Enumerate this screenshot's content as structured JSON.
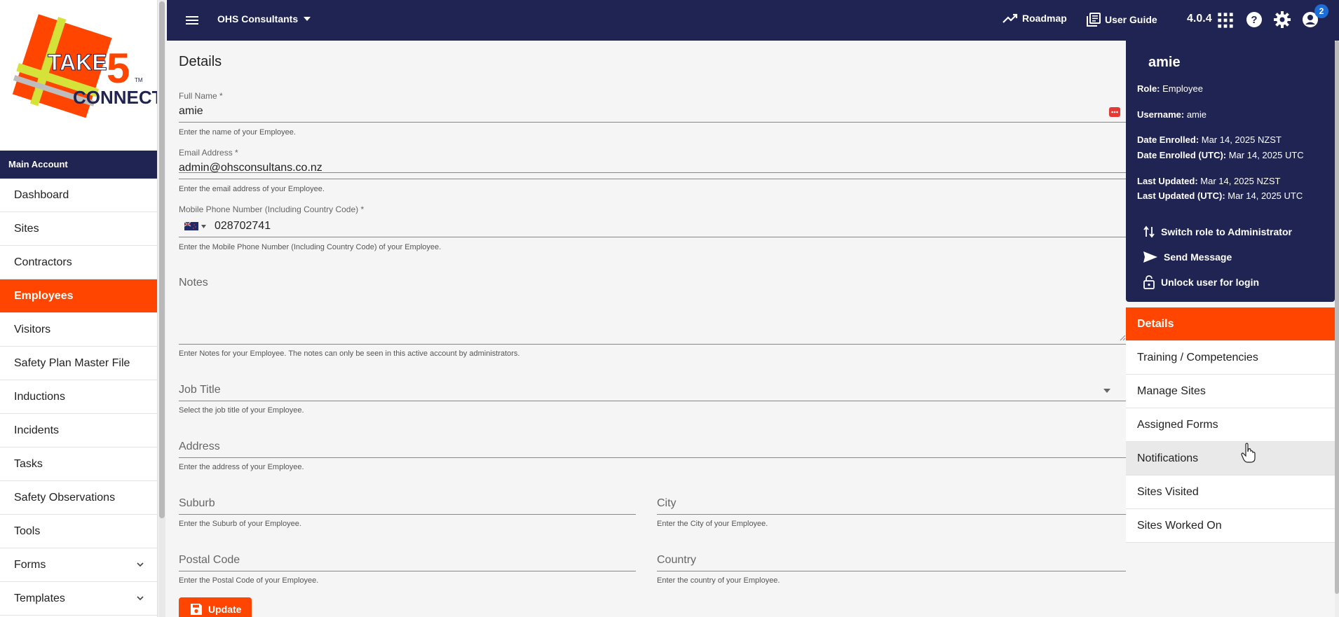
{
  "logo": {
    "text_main": "TAKE",
    "text_num": "5",
    "text_sub": "CONNECT",
    "tm": "TM"
  },
  "sidebar": {
    "section_title": "Main Account",
    "items": [
      {
        "label": "Dashboard"
      },
      {
        "label": "Sites"
      },
      {
        "label": "Contractors"
      },
      {
        "label": "Employees"
      },
      {
        "label": "Visitors"
      },
      {
        "label": "Safety Plan Master File"
      },
      {
        "label": "Inductions"
      },
      {
        "label": "Incidents"
      },
      {
        "label": "Tasks"
      },
      {
        "label": "Safety Observations"
      },
      {
        "label": "Tools"
      },
      {
        "label": "Forms"
      },
      {
        "label": "Templates"
      }
    ],
    "active_item": "Employees"
  },
  "topbar": {
    "account": "OHS Consultants",
    "roadmap": "Roadmap",
    "user_guide": "User Guide",
    "version": "4.0.4",
    "notification_count": "2"
  },
  "form": {
    "title": "Details",
    "full_name": {
      "label": "Full Name *",
      "value": "amie",
      "helper": "Enter the name of your Employee."
    },
    "email": {
      "label": "Email Address *",
      "value": "admin@ohsconsultans.co.nz",
      "helper": "Enter the email address of your Employee."
    },
    "mobile": {
      "label": "Mobile Phone Number (Including Country Code) *",
      "value": "028702741",
      "helper": "Enter the Mobile Phone Number (Including Country Code) of your Employee."
    },
    "notes": {
      "placeholder": "Notes",
      "helper": "Enter Notes for your Employee. The notes can only be seen in this active account by administrators."
    },
    "job_title": {
      "placeholder": "Job Title",
      "helper": "Select the job title of your Employee."
    },
    "address": {
      "placeholder": "Address",
      "helper": "Enter the address of your Employee."
    },
    "suburb": {
      "placeholder": "Suburb",
      "helper": "Enter the Suburb of your Employee."
    },
    "city": {
      "placeholder": "City",
      "helper": "Enter the City of your Employee."
    },
    "postal_code": {
      "placeholder": "Postal Code",
      "helper": "Enter the Postal Code of your Employee."
    },
    "country": {
      "placeholder": "Country",
      "helper": "Enter the country of your Employee."
    },
    "update_label": "Update"
  },
  "user_card": {
    "name": "amie",
    "role_label": "Role:",
    "role": "Employee",
    "username_label": "Username:",
    "username": "amie",
    "enrolled_label": "Date Enrolled:",
    "enrolled": "Mar 14, 2025 NZST",
    "enrolled_utc_label": "Date Enrolled (UTC):",
    "enrolled_utc": "Mar 14, 2025 UTC",
    "updated_label": "Last Updated:",
    "updated": "Mar 14, 2025 NZST",
    "updated_utc_label": "Last Updated (UTC):",
    "updated_utc": "Mar 14, 2025 UTC",
    "actions": {
      "switch_role": "Switch role to Administrator",
      "send_message": "Send Message",
      "unlock": "Unlock user for login"
    }
  },
  "tabs": [
    {
      "label": "Details"
    },
    {
      "label": "Training / Competencies"
    },
    {
      "label": "Manage Sites"
    },
    {
      "label": "Assigned Forms"
    },
    {
      "label": "Notifications"
    },
    {
      "label": "Sites Visited"
    },
    {
      "label": "Sites Worked On"
    }
  ],
  "colors": {
    "navy": "#1f2452",
    "accent": "#ff4500"
  }
}
